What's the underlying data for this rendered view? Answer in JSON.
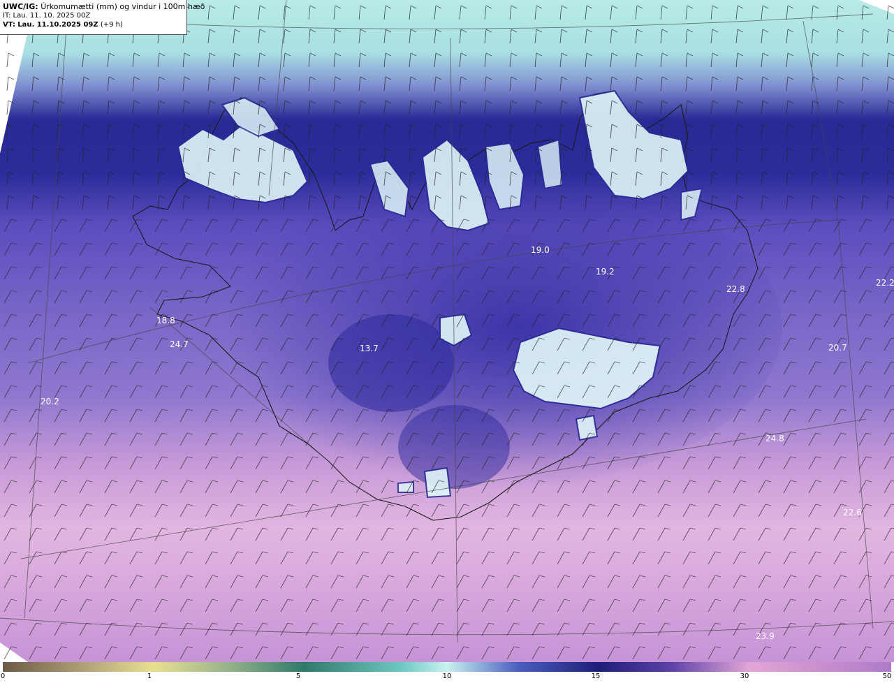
{
  "header": {
    "line1_prefix": "UWC/IG:",
    "line1_text": "Úrkomumætti (mm) og vindur i 100m hæð",
    "line2": "IT: Lau. 11. 10. 2025 00Z",
    "line3_prefix": "VT:",
    "line3_bold": "Lau. 11.10.2025 09Z",
    "line3_suffix": "(+9 h)"
  },
  "colorbar": {
    "ticks": [
      {
        "label": "0",
        "value": 0
      },
      {
        "label": "1",
        "value": 1
      },
      {
        "label": "5",
        "value": 5
      },
      {
        "label": "10",
        "value": 10
      },
      {
        "label": "15",
        "value": 15
      },
      {
        "label": "30",
        "value": 30
      },
      {
        "label": "50",
        "value": 50
      }
    ],
    "colors": [
      "#6b5a45",
      "#c9b98c",
      "#e8e090",
      "#2e7a6a",
      "#a9e8e8",
      "#23238f",
      "#e2a5d5",
      "#b07ac8"
    ]
  },
  "map_labels": [
    {
      "text": "19.0"
    },
    {
      "text": "19.2"
    },
    {
      "text": "22.8"
    },
    {
      "text": "22.2"
    },
    {
      "text": "18.8"
    },
    {
      "text": "24.7"
    },
    {
      "text": "13.7"
    },
    {
      "text": "20.2"
    },
    {
      "text": "20.7"
    },
    {
      "text": "24.8"
    },
    {
      "text": "22.6"
    },
    {
      "text": "23.9"
    }
  ],
  "colors": {
    "sea_light": "#b9ece6",
    "precip_band": "#23238f",
    "precip_mid": "#6a55c0",
    "precip_south": "#e2b3e0",
    "snow_glacier": "#dff5f8"
  }
}
